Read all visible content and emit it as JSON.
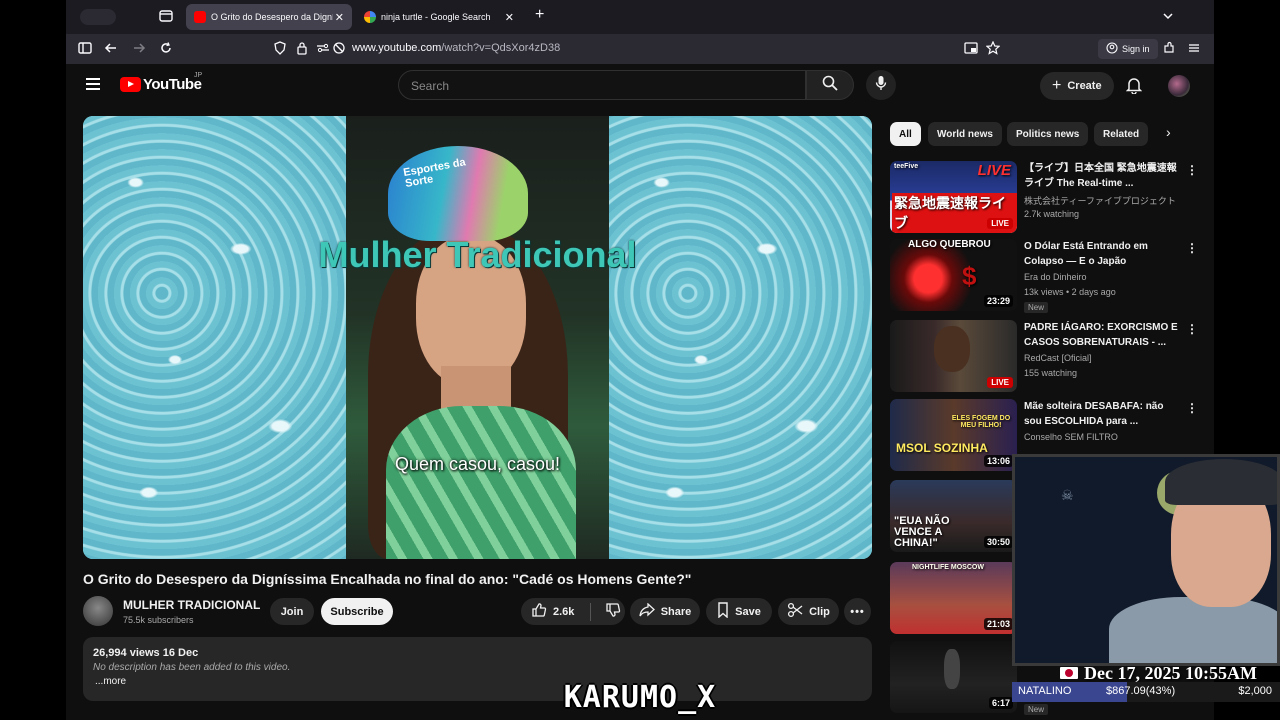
{
  "browser": {
    "tabs": [
      {
        "title": "O Grito do Desespero da Digníssima",
        "active": true
      },
      {
        "title": "ninja turtle - Google Search",
        "active": false
      }
    ],
    "url_host": "www.youtube.com",
    "url_path": "/watch?v=QdsXor4zD38",
    "sign_in": "Sign in"
  },
  "header": {
    "logo_text": "YouTube",
    "region": "JP",
    "search_placeholder": "Search",
    "create_label": "Create"
  },
  "player": {
    "overlay_title": "Mulher Tradicional",
    "caption": "Quem casou, casou!",
    "hat_text": "Esportes da Sorte"
  },
  "video": {
    "title": "O Grito do Desespero da Digníssima Encalhada no final do ano: \"Cadé os Homens Gente?\"",
    "channel": "MULHER TRADICIONAL",
    "subscribers": "75.5k subscribers",
    "join": "Join",
    "subscribe": "Subscribe",
    "likes": "2.6k",
    "share": "Share",
    "save": "Save",
    "clip": "Clip",
    "views_date": "26,994 views  16 Dec",
    "description": "No description has been added to this video.",
    "more": "...more"
  },
  "chips": [
    "All",
    "World news",
    "Politics news",
    "Related"
  ],
  "recommendations": [
    {
      "title": "【ライブ】日本全国 緊急地震速報ライブ The Real-time ...",
      "channel": "株式会社ティーファイブプロジェクト",
      "meta": "2.7k watching",
      "badge": "LIVE",
      "thumb_text": "緊急地震速報ライブ",
      "thumb_top": "LIVE",
      "brand": "teeFive"
    },
    {
      "title": "O Dólar Está Entrando em Colapso — E o Japão Acelerou...",
      "channel": "Era do Dinheiro",
      "meta": "13k views • 2 days ago",
      "badge": "23:29",
      "new": "New",
      "thumb_text": "ALGO QUEBROU"
    },
    {
      "title": "PADRE IÁGARO: EXORCISMO E CASOS SOBRENATURAIS - ...",
      "channel": "RedCast [Oficial]",
      "meta": "155 watching",
      "badge": "LIVE"
    },
    {
      "title": "Mãe solteira DESABAFA: não sou ESCOLHIDA para ...",
      "channel": "Conselho SEM FILTRO",
      "meta": "",
      "badge": "13:06",
      "thumb_text": "MSOL SOZINHA",
      "thumb_sub": "ELES FOGEM DO MEU FILHO!"
    },
    {
      "title": "",
      "channel": "",
      "meta": "",
      "badge": "30:50",
      "thumb_text": "\"EUA NÃO VENCE A CHINA!\""
    },
    {
      "title": "",
      "channel": "",
      "meta": "",
      "badge": "21:03",
      "thumb_text": "NIGHTLIFE MOSCOW"
    },
    {
      "title": "",
      "channel": "",
      "meta": "",
      "badge": "6:17",
      "new": "New"
    }
  ],
  "stream_overlay": {
    "datetime": "Dec 17, 2025 10:55AM",
    "donor": "NATALINO",
    "amount": "$867.09(43%)",
    "goal": "$2,000",
    "progress": 0.43,
    "watermark": "KARUMO_X"
  },
  "colors": {
    "accent_red": "#ff0000",
    "bg": "#0f0f0f",
    "chip": "#272727"
  }
}
